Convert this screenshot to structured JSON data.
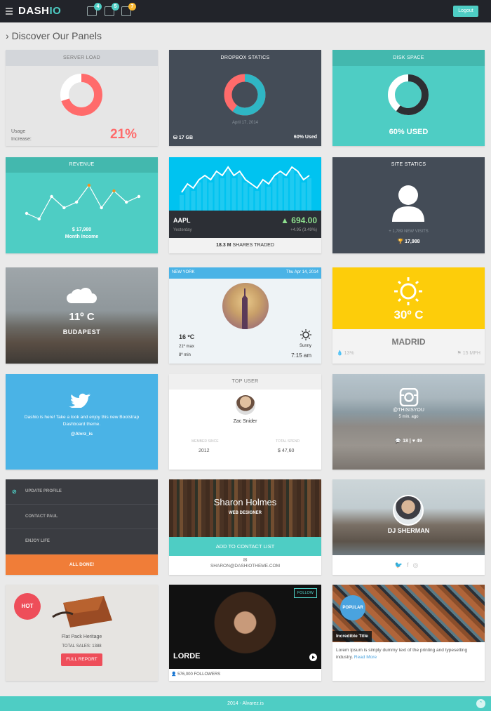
{
  "header": {
    "logo_main": "DASH",
    "logo_accent": "IO",
    "badges": [
      "4",
      "5",
      "7"
    ],
    "logout": "Logout"
  },
  "page_title": "Discover Our Panels",
  "server_load": {
    "title": "SERVER LOAD",
    "usage_line1": "Usage",
    "usage_line2": "Increase:",
    "percent": "21%",
    "fill": 0.7
  },
  "dropbox": {
    "title": "DROPBOX STATICS",
    "date": "April 17, 2014",
    "size": "17 GB",
    "used": "60% Used",
    "fill": 0.6
  },
  "disk": {
    "title": "DISK SPACE",
    "label": "60% USED",
    "fill": 0.6
  },
  "revenue": {
    "title": "REVENUE",
    "amount": "$ 17,980",
    "subtitle": "Month Income",
    "points": [
      4,
      3,
      7,
      5,
      6,
      9,
      5,
      8,
      6,
      7
    ],
    "highlight": [
      5,
      7
    ]
  },
  "stock": {
    "symbol": "AAPL",
    "yesterday": "Yesterday",
    "price": "694.00",
    "change": "+4.95 (3.49%)",
    "shares_value": "18.3 M",
    "shares_label": "SHARES TRADED",
    "series": [
      3,
      5,
      4,
      6,
      7,
      6,
      8,
      7,
      9,
      7,
      8,
      6,
      5,
      4,
      6,
      5,
      7,
      8,
      7,
      9,
      8,
      6,
      7
    ]
  },
  "site_statics": {
    "title": "SITE STATICS",
    "visits": "+ 1,789 NEW VISITS",
    "total": "17,988"
  },
  "city_weather": {
    "temp": "11º C",
    "city": "BUDAPEST"
  },
  "ny_weather": {
    "city": "NEW YORK",
    "date": "Thu Apr 14, 2014",
    "temp": "16 ºC",
    "max": "21º max",
    "min": "8º min",
    "condition": "Sunny",
    "time": "7:15 am"
  },
  "madrid": {
    "temp": "30º C",
    "city": "MADRID",
    "humidity": "13%",
    "wind": "15 MPH"
  },
  "twitter": {
    "message": "Dashio is here! Take a look and enjoy this new Bootstrap Dashboard theme.",
    "handle": "@Alvrz_is"
  },
  "top_user": {
    "title": "TOP USER",
    "name": "Zac Snider",
    "member_label": "MEMBER SINCE",
    "member_value": "2012",
    "spend_label": "TOTAL SPEND",
    "spend_value": "$ 47,60"
  },
  "instagram": {
    "user": "@THISISYOU",
    "ago": "5 min. ago",
    "comments": "18",
    "likes": "49"
  },
  "todo": {
    "items": [
      "UPDATE PROFILE",
      "CONTACT PAUL",
      "ENJOY LIFE"
    ],
    "done": "ALL DONE!"
  },
  "profile": {
    "name": "Sharon Holmes",
    "role": "WEB DESIGNER",
    "add": "ADD TO CONTACT LIST",
    "email": "SHARON@DASHIOTHEME.COM"
  },
  "dj": {
    "name": "DJ SHERMAN"
  },
  "product": {
    "badge": "HOT",
    "name": "Flat Pack Heritage",
    "sales": "TOTAL SALES: 1388",
    "button": "FULL REPORT"
  },
  "music": {
    "follow": "FOLLOW",
    "artist": "LORDE",
    "followers": "576,000 FOLLOWERS"
  },
  "blog": {
    "badge": "POPULAR",
    "title": "Incredible Title",
    "text": "Lorem Ipsum is simply dummy text of the printing and typesetting industry.",
    "more": "Read More"
  },
  "footer": {
    "text": "2014 - Alvarez.is"
  },
  "colors": {
    "teal": "#4ecdc4",
    "coral": "#ff6b6b",
    "dark": "#444c57",
    "orange": "#f07d38",
    "blue": "#4ab3e6",
    "yellow": "#fdcd0a"
  }
}
